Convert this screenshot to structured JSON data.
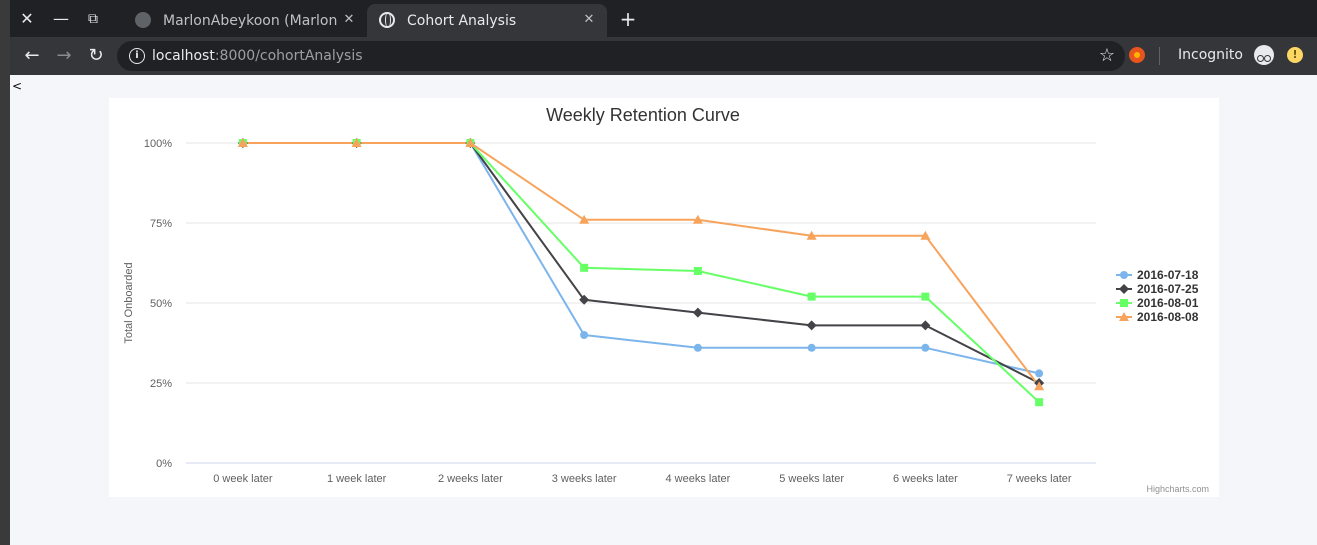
{
  "window": {
    "close_glyph": "✕",
    "minimize_glyph": "—",
    "restore_glyph": "⧉"
  },
  "tabs": [
    {
      "title": "MarlonAbeykoon (Marlon",
      "icon": "github-icon",
      "close_glyph": "✕",
      "active": false
    },
    {
      "title": "Cohort Analysis",
      "icon": "globe-icon",
      "close_glyph": "✕",
      "active": true
    }
  ],
  "new_tab_glyph": "+",
  "toolbar": {
    "back_glyph": "←",
    "forward_glyph": "→",
    "reload_glyph": "↻",
    "url_host": "localhost",
    "url_rest": ":8000/cohortAnalysis",
    "star_glyph": "☆",
    "incognito_label": "Incognito",
    "menu_glyph": "!"
  },
  "page": {
    "stray_text": "<"
  },
  "colors": {
    "series": [
      "#7cb5ec",
      "#434348",
      "#66ff66",
      "#f7a35c"
    ],
    "grid": "#e6e6e6"
  },
  "chart_data": {
    "type": "line",
    "title": "Weekly Retention Curve",
    "xlabel": "",
    "ylabel": "Total Onboarded",
    "categories": [
      "0 week later",
      "1 week later",
      "2 weeks later",
      "3 weeks later",
      "4 weeks later",
      "5 weeks later",
      "6 weeks later",
      "7 weeks later"
    ],
    "y_ticks": [
      "0%",
      "25%",
      "50%",
      "75%",
      "100%"
    ],
    "ylim": [
      0,
      100
    ],
    "grid": true,
    "legend_placement": "right",
    "series": [
      {
        "name": "2016-07-18",
        "marker": "circle",
        "color": "#7cb5ec",
        "values": [
          100,
          100,
          100,
          40,
          36,
          36,
          36,
          28
        ]
      },
      {
        "name": "2016-07-25",
        "marker": "diamond",
        "color": "#434348",
        "values": [
          100,
          100,
          100,
          51,
          47,
          43,
          43,
          25
        ]
      },
      {
        "name": "2016-08-01",
        "marker": "square",
        "color": "#66ff66",
        "values": [
          100,
          100,
          100,
          61,
          60,
          52,
          52,
          19
        ]
      },
      {
        "name": "2016-08-08",
        "marker": "triangle",
        "color": "#f7a35c",
        "values": [
          100,
          100,
          100,
          76,
          76,
          71,
          71,
          24
        ]
      }
    ],
    "credits": "Highcharts.com"
  }
}
